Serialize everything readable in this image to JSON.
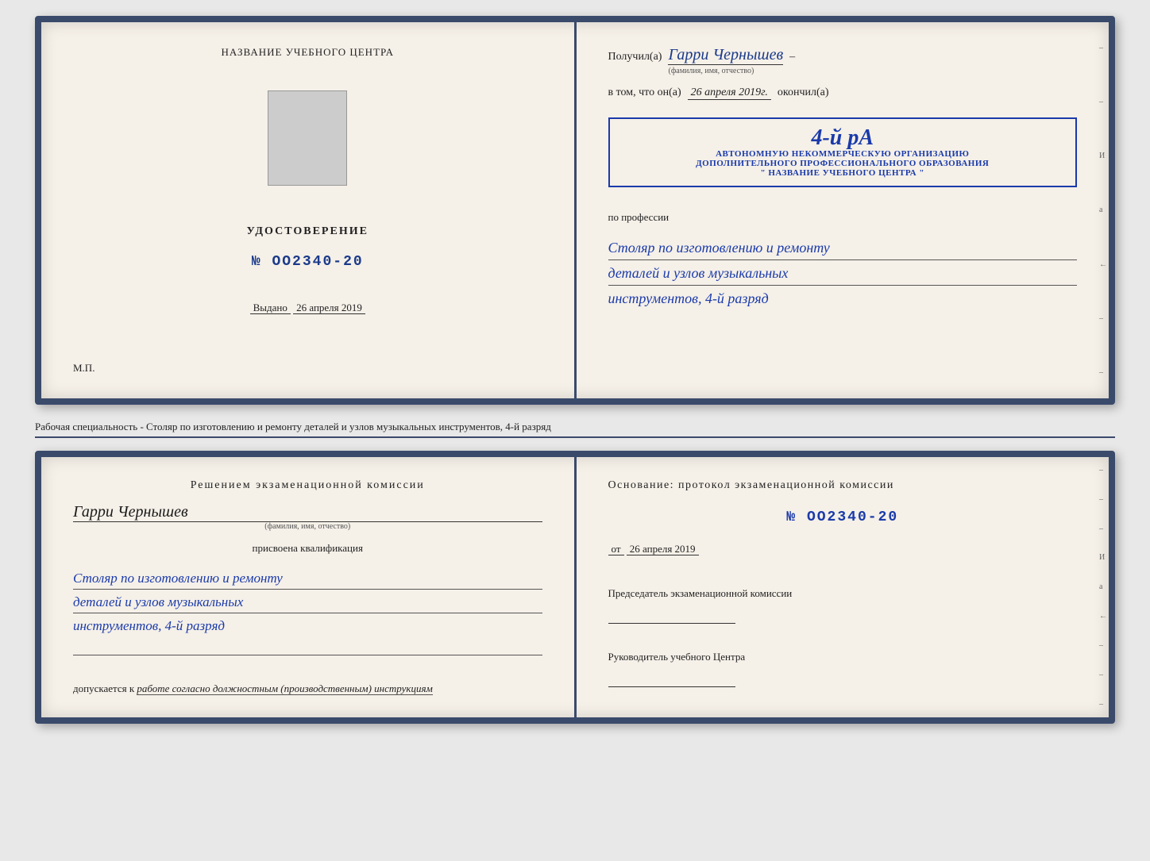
{
  "top_doc": {
    "left": {
      "center_title": "НАЗВАНИЕ УЧЕБНОГО ЦЕНТРА",
      "udostoverenie_label": "УДОСТОВЕРЕНИЕ",
      "number_prefix": "№",
      "number": "OO2340-20",
      "vydano_label": "Выдано",
      "vydano_date": "26 апреля 2019",
      "mp_label": "М.П."
    },
    "right": {
      "poluchil_label": "Получил(а)",
      "recipient_name": "Гарри Чернышев",
      "fio_subtext": "(фамилия, имя, отчество)",
      "vtom_prefix": "в том, что он(а)",
      "vtom_date": "26 апреля 2019г.",
      "okonchil_label": "окончил(а)",
      "stamp_line1": "4-й рА",
      "stamp_line2": "АВТОНОМНУЮ НЕКОММЕРЧЕСКУЮ ОРГАНИЗАЦИЮ",
      "stamp_line3": "ДОПОЛНИТЕЛЬНОГО ПРОФЕССИОНАЛЬНОГО ОБРАЗОВАНИЯ",
      "stamp_line4": "\" НАЗВАНИЕ УЧЕБНОГО ЦЕНТРА \"",
      "po_professii_label": "по профессии",
      "profession_line1": "Столяр по изготовлению и ремонту",
      "profession_line2": "деталей и узлов музыкальных",
      "profession_line3": "инструментов, 4-й разряд"
    }
  },
  "caption": {
    "text": "Рабочая специальность - Столяр по изготовлению и ремонту деталей и узлов музыкальных инструментов, 4-й разряд"
  },
  "bottom_doc": {
    "left": {
      "resheniem_title": "Решением  экзаменационной  комиссии",
      "name": "Гарри Чернышев",
      "fio_subtext": "(фамилия, имя, отчество)",
      "prisvoena_label": "присвоена квалификация",
      "kvali_line1": "Столяр по изготовлению и ремонту",
      "kvali_line2": "деталей и узлов музыкальных",
      "kvali_line3": "инструментов, 4-й разряд",
      "dopuskaetsya_prefix": "допускается к",
      "dopusk_text": "работе согласно должностным (производственным) инструкциям"
    },
    "right": {
      "osnovanie_label": "Основание: протокол экзаменационной  комиссии",
      "number_prefix": "№",
      "number": "OO2340-20",
      "ot_prefix": "от",
      "ot_date": "26 апреля 2019",
      "predsedatel_label": "Председатель экзаменационной комиссии",
      "rukovoditel_label": "Руководитель учебного Центра"
    }
  },
  "side_labels": {
    "И": "И",
    "а": "а",
    "left_arrow": "←"
  },
  "dashes": [
    "-",
    "-",
    "-",
    "-",
    "И",
    "а",
    "←",
    "-",
    "-",
    "-",
    "-"
  ]
}
